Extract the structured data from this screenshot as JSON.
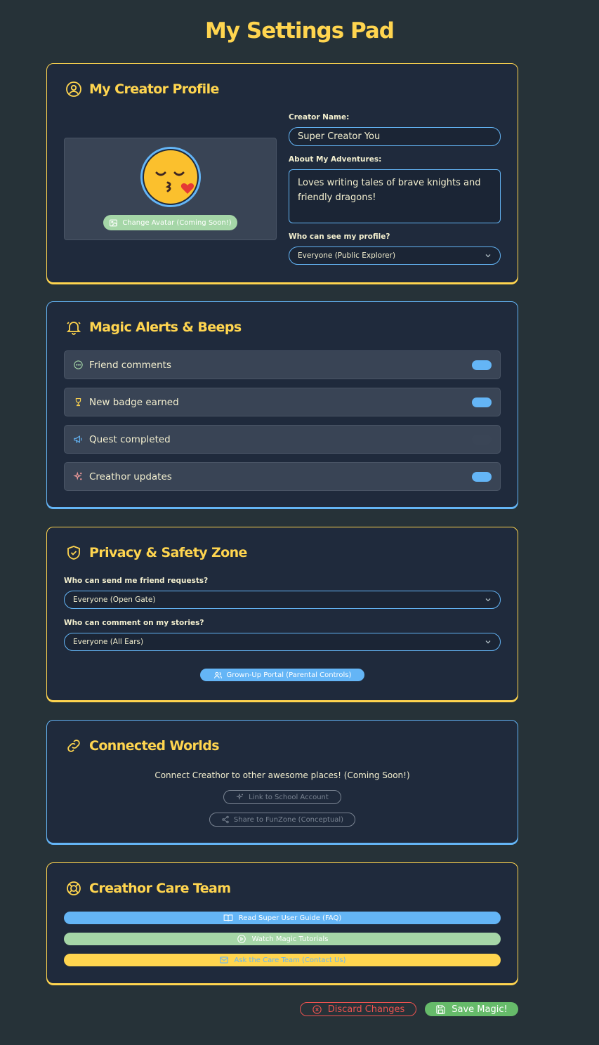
{
  "title": "My Settings Pad",
  "profile": {
    "heading": "My Creator Profile",
    "name_label": "Creator Name:",
    "name_value": "Super Creator You",
    "about_label": "About My Adventures:",
    "about_value": "Loves writing tales of brave knights and friendly dragons!",
    "visibility_label": "Who can see my profile?",
    "visibility_value": "Everyone (Public Explorer)",
    "change_avatar": "Change Avatar (Coming Soon!)",
    "avatar_emoji": "😘"
  },
  "alerts": {
    "heading": "Magic Alerts & Beeps",
    "items": [
      {
        "label": "Friend comments",
        "icon": "chat-bubble-icon",
        "on": true
      },
      {
        "label": "New badge earned",
        "icon": "trophy-icon",
        "on": true
      },
      {
        "label": "Quest completed",
        "icon": "megaphone-icon",
        "on": false
      },
      {
        "label": "Creathor updates",
        "icon": "sparkles-icon",
        "on": true
      }
    ]
  },
  "privacy": {
    "heading": "Privacy & Safety Zone",
    "friend_label": "Who can send me friend requests?",
    "friend_value": "Everyone (Open Gate)",
    "comment_label": "Who can comment on my stories?",
    "comment_value": "Everyone (All Ears)",
    "portal": "Grown-Up Portal (Parental Controls)"
  },
  "connected": {
    "heading": "Connected Worlds",
    "intro": "Connect Creathor to other awesome places! (Coming Soon!)",
    "school": "Link to School Account",
    "share": "Share to FunZone (Conceptual)"
  },
  "care": {
    "heading": "Creathor Care Team",
    "faq": "Read Super User Guide (FAQ)",
    "tutorials": "Watch Magic Tutorials",
    "contact": "Ask the Care Team (Contact Us)"
  },
  "footer": {
    "discard": "Discard Changes",
    "save": "Save Magic!"
  },
  "colors": {
    "background": "#263238",
    "card": "#1f2a3c",
    "yellow": "#ffd54f",
    "blue": "#64b5f6",
    "green": "#a5d6a7",
    "red": "#ef5350",
    "save_green": "#66bb6a"
  }
}
